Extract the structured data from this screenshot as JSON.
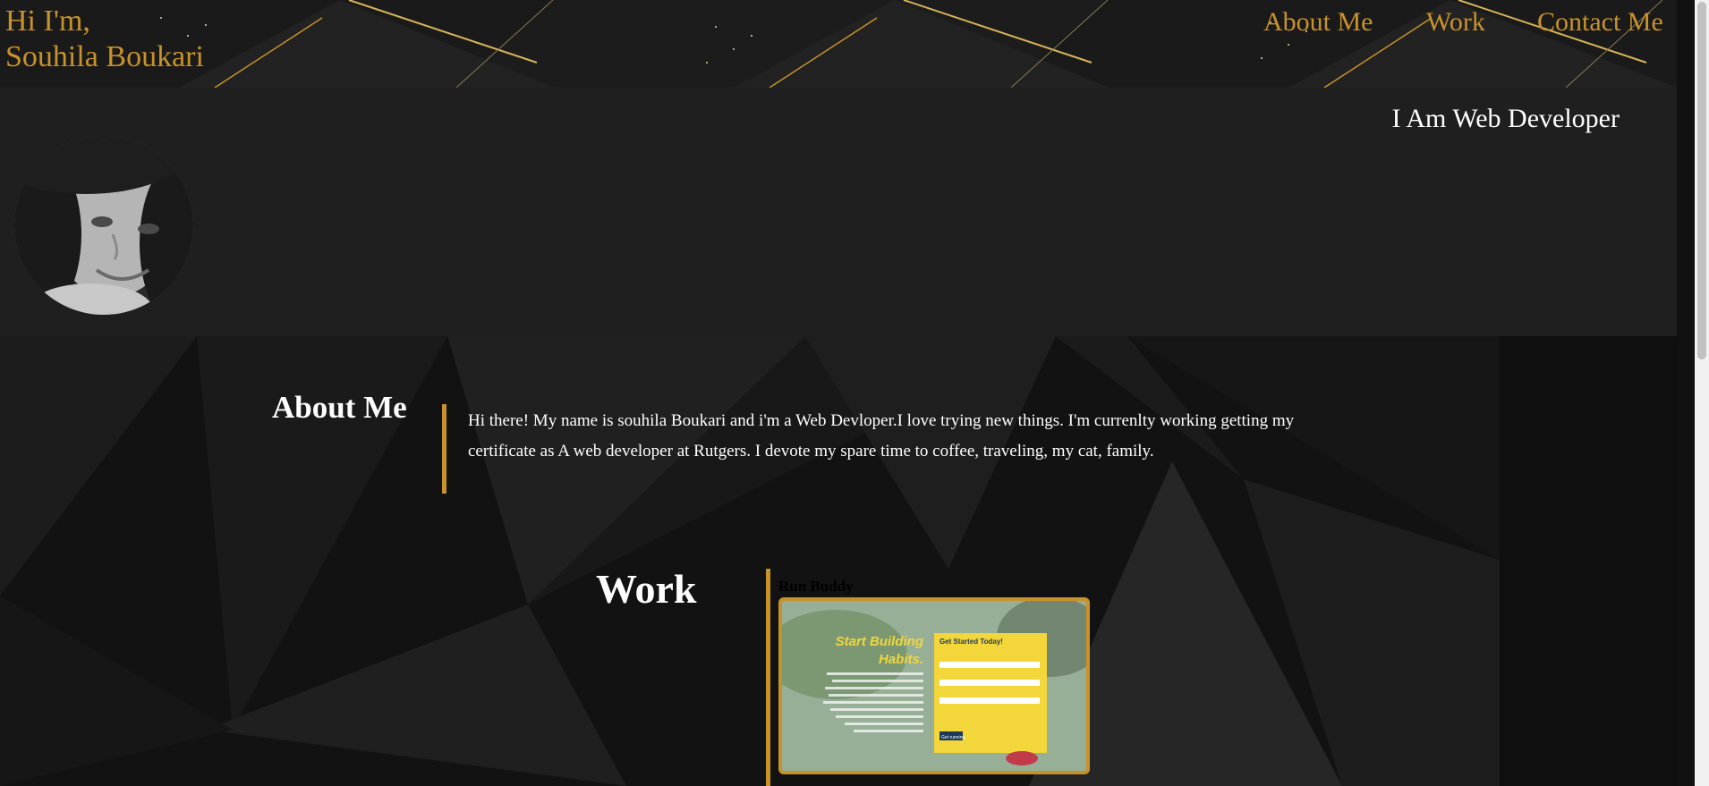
{
  "header": {
    "greeting": "Hi I'm,",
    "name": "Souhila Boukari",
    "nav": [
      {
        "label": "About Me"
      },
      {
        "label": "Work"
      },
      {
        "label": "Contact Me"
      }
    ]
  },
  "banner": {
    "tagline": "I Am Web Developer"
  },
  "about": {
    "title": "About Me",
    "text": "Hi there! My name is souhila Boukari and i'm a Web Devloper.I love trying new things. I'm currenlty working getting my certificate as A web developer at Rutgers. I devote my spare time to coffee, traveling, my cat, family."
  },
  "work": {
    "title": "Work",
    "projects": [
      {
        "title": "Run Buddy",
        "hero_heading_1": "Start Building",
        "hero_heading_2": "Habits.",
        "form_title": "Get Started Today!",
        "form_button": "Get running"
      }
    ]
  },
  "colors": {
    "accent": "#c8922a",
    "banner_bg": "#1f1f1f",
    "main_bg": "#141414"
  }
}
